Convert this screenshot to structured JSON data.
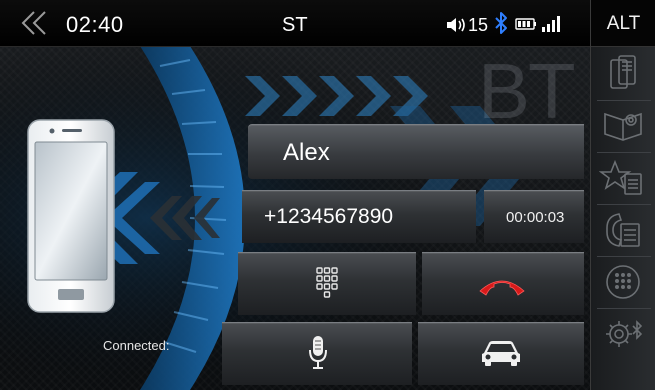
{
  "status_bar": {
    "time": "02:40",
    "source": "ST",
    "volume": "15",
    "back_icon": "chevron-left-icon",
    "volume_icon": "speaker-icon",
    "bluetooth_icon": "bluetooth-icon",
    "battery_icon": "battery-icon",
    "signal_icon": "signal-icon"
  },
  "side_menu": {
    "alt_label": "ALT",
    "items": [
      {
        "icon": "phone-transfer-icon"
      },
      {
        "icon": "phonebook-icon"
      },
      {
        "icon": "favorites-icon"
      },
      {
        "icon": "call-history-icon"
      },
      {
        "icon": "keypad-icon"
      },
      {
        "icon": "bluetooth-settings-icon"
      }
    ]
  },
  "background": {
    "brand_text": "BT"
  },
  "device": {
    "status_label": "Connected:"
  },
  "call": {
    "caller_name": "Alex",
    "phone_number": "+1234567890",
    "duration": "00:00:03"
  },
  "controls": {
    "keypad_icon": "dialpad-icon",
    "hangup_icon": "hang-up-icon",
    "mic_icon": "microphone-icon",
    "car_icon": "car-audio-icon"
  },
  "colors": {
    "accent_blue": "#2a8fd8",
    "hangup_red": "#d81a1a",
    "bluetooth_blue": "#2f7fff"
  }
}
